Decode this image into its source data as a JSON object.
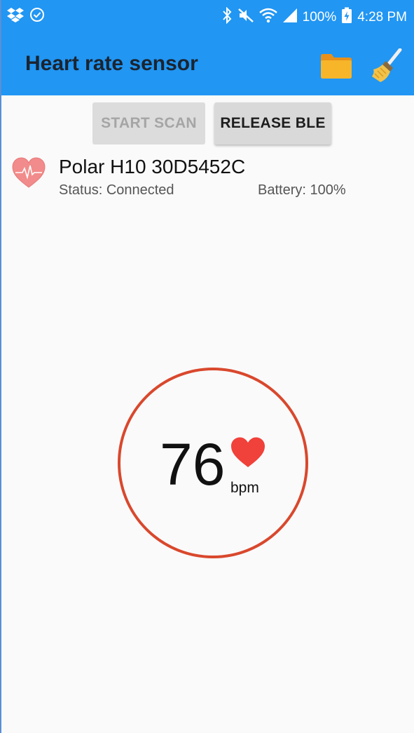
{
  "status_bar": {
    "battery": "100%",
    "time": "4:28 PM"
  },
  "app_bar": {
    "title": "Heart rate sensor",
    "actions": [
      {
        "icon": "folder-icon"
      },
      {
        "icon": "broom-icon"
      }
    ]
  },
  "buttons": {
    "start_scan": "START SCAN",
    "release_ble": "RELEASE BLE"
  },
  "device": {
    "name": "Polar H10 30D5452C",
    "status": "Status: Connected",
    "battery": "Battery: 100%"
  },
  "heart_rate": {
    "value": "76",
    "unit": "bpm"
  },
  "colors": {
    "primary": "#2196f3",
    "gauge_ring": "#d9482d",
    "heart": "#f0413a",
    "folder": "#f7a51a"
  }
}
